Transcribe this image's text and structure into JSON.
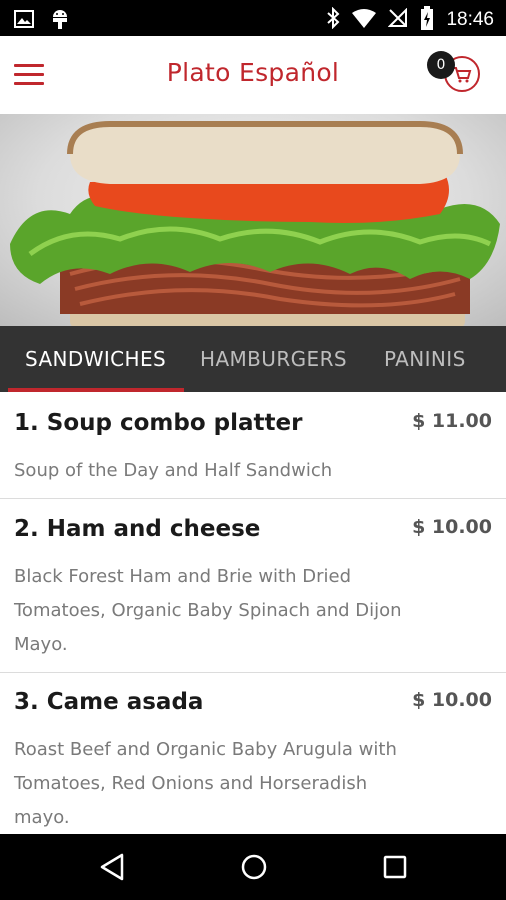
{
  "status_bar": {
    "time": "18:46",
    "left_icons": [
      "image-icon",
      "android-icon"
    ],
    "right_icons": [
      "bluetooth-icon",
      "wifi-icon",
      "no-sim-icon",
      "battery-charging-icon"
    ]
  },
  "app_bar": {
    "title": "Plato Español",
    "cart_count": "0",
    "accent_color": "#c0272d"
  },
  "tabs": [
    {
      "label": "SANDWICHES",
      "active": true
    },
    {
      "label": "HAMBURGERS",
      "active": false
    },
    {
      "label": "PANINIS",
      "active": false
    }
  ],
  "menu_items": [
    {
      "name": "1. Soup combo platter",
      "price": "$ 11.00",
      "description": "Soup of the Day and Half Sandwich"
    },
    {
      "name": "2. Ham and cheese",
      "price": "$ 10.00",
      "description": "Black Forest Ham and Brie with Dried Tomatoes, Organic Baby Spinach and Dijon Mayo."
    },
    {
      "name": "3. Came asada",
      "price": "$ 10.00",
      "description": "Roast Beef and Organic Baby Arugula with Tomatoes, Red Onions and Horseradish mayo."
    }
  ],
  "nav_bar": {
    "buttons": [
      "back-icon",
      "home-icon",
      "recents-icon"
    ]
  }
}
